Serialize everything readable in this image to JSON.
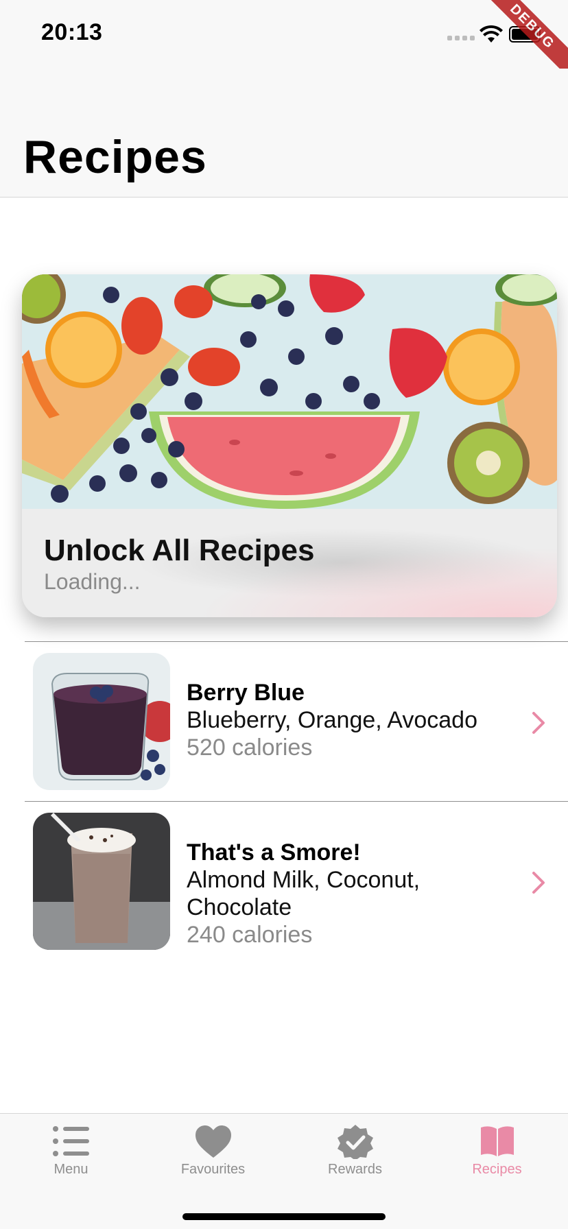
{
  "status_bar": {
    "time": "20:13",
    "debug_label": "DEBUG"
  },
  "header": {
    "title": "Recipes"
  },
  "hero": {
    "title": "Unlock All Recipes",
    "subtitle": "Loading..."
  },
  "recipes": [
    {
      "name": "Berry Blue",
      "ingredients": "Blueberry, Orange, Avocado",
      "calories": "520 calories"
    },
    {
      "name": "That's a Smore!",
      "ingredients": "Almond Milk, Coconut, Chocolate",
      "calories": "240 calories"
    }
  ],
  "tabs": [
    {
      "label": "Menu",
      "icon": "list-icon",
      "active": false
    },
    {
      "label": "Favourites",
      "icon": "heart-icon",
      "active": false
    },
    {
      "label": "Rewards",
      "icon": "checkmark-seal-icon",
      "active": false
    },
    {
      "label": "Recipes",
      "icon": "book-icon",
      "active": true
    }
  ],
  "colors": {
    "accent": "#e98aa6",
    "inactive": "#8e8e8e",
    "debug": "#b71c1c"
  }
}
